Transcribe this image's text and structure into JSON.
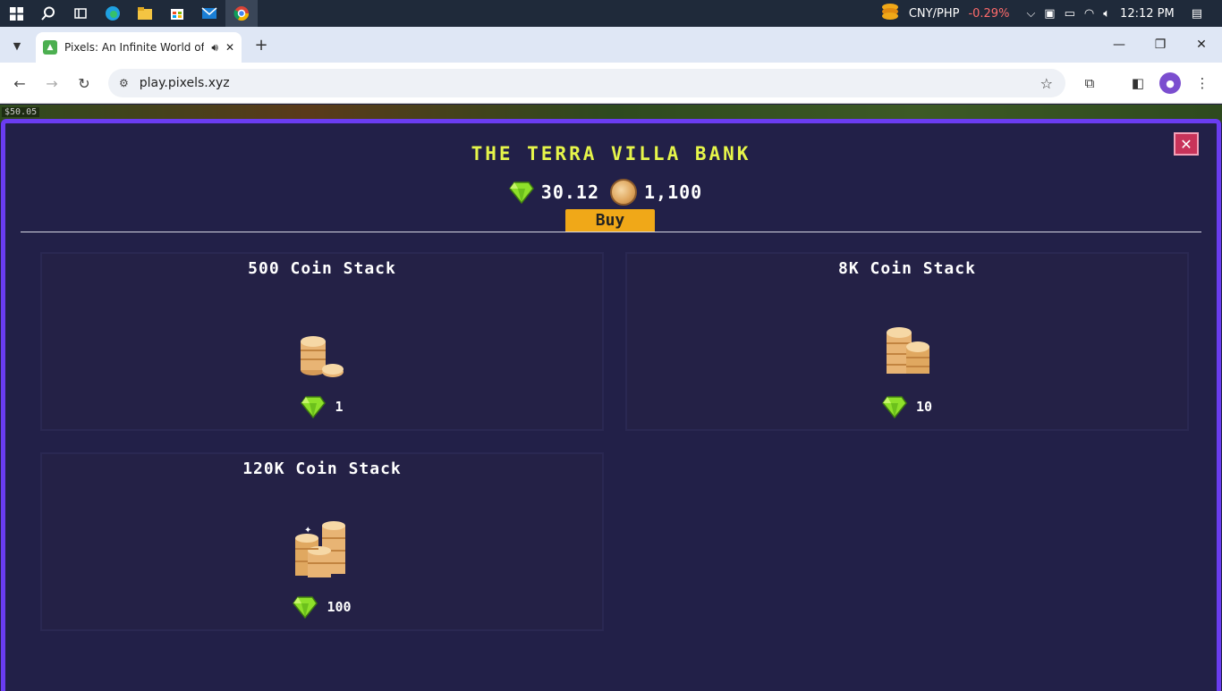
{
  "taskbar": {
    "ticker_pair": "CNY/PHP",
    "ticker_change": "-0.29%",
    "clock": "12:12 PM"
  },
  "browser": {
    "tab_title": "Pixels: An Infinite World of E",
    "url": "play.pixels.xyz",
    "new_tab_symbol": "+"
  },
  "game": {
    "hud_text": "$50.05"
  },
  "bank": {
    "title": "THE TERRA VILLA BANK",
    "gem_balance": "30.12",
    "coin_balance": "1,100",
    "buy_label": "Buy",
    "close_symbol": "✕",
    "items": [
      {
        "name": "500 Coin Stack",
        "price": "1"
      },
      {
        "name": "8K Coin Stack",
        "price": "10"
      },
      {
        "name": "120K Coin Stack",
        "price": "100"
      }
    ]
  },
  "colors": {
    "modal_bg": "#222048",
    "modal_border": "#6a3cf0",
    "title_yellow": "#e6f54a",
    "buy_orange": "#f0a818",
    "close_red": "#c8335a"
  }
}
